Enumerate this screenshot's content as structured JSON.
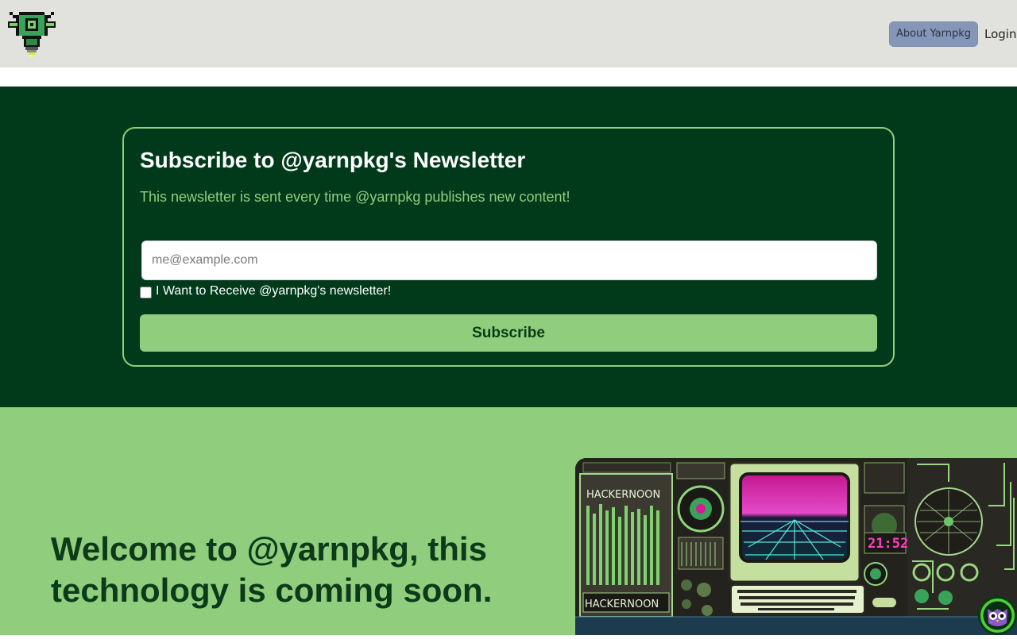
{
  "header": {
    "logo_icon": "robot-lightbulb-logo-icon",
    "about_label": "About Yarnpkg",
    "login_label": "Login"
  },
  "newsletter": {
    "title": "Subscribe to @yarnpkg's Newsletter",
    "subtitle": "This newsletter is sent every time @yarnpkg publishes new content!",
    "email_placeholder": "me@example.com",
    "email_value": "",
    "consent_label": "I Want to Receive @yarnpkg's newsletter!",
    "consent_checked": false,
    "subscribe_label": "Subscribe"
  },
  "hero": {
    "heading": "Welcome to @yarnpkg, this technology is coming soon.",
    "art": {
      "brand_top": "HACKERNOON",
      "brand_bottom": "HACKERNOON",
      "clock": "21:52"
    },
    "owl_icon": "hackernoon-owl-icon"
  },
  "colors": {
    "header_bg": "#e1e1de",
    "newsletter_bg": "#003a1b",
    "accent_green": "#90cd7c",
    "dark_green_text": "#0c3a1a",
    "about_button_bg": "#8497b8"
  }
}
